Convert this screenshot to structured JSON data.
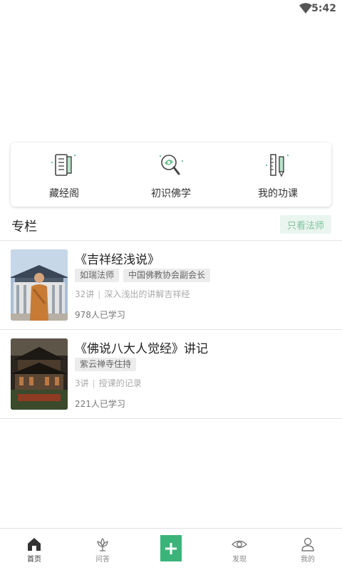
{
  "status_bar": {
    "time": "5:42"
  },
  "quick_links": [
    {
      "label": "藏经阁",
      "icon": "scripture-book-icon"
    },
    {
      "label": "初识佛学",
      "icon": "magnifier-leaf-icon"
    },
    {
      "label": "我的功课",
      "icon": "ruler-pencil-icon"
    }
  ],
  "section": {
    "title": "专栏",
    "filter_label": "只看法师"
  },
  "courses": [
    {
      "title": "《吉祥经浅说》",
      "tags": [
        "如瑞法师",
        "中国佛教协会副会长"
      ],
      "lecture_count": "32讲",
      "description": "深入浅出的讲解吉祥经",
      "learners": "978人已学习"
    },
    {
      "title": "《佛说八大人觉经》讲记",
      "tags": [
        "紫云禅寺住持"
      ],
      "lecture_count": "3讲",
      "description": "授课的记录",
      "learners": "221人已学习"
    }
  ],
  "tab_bar": {
    "tabs": [
      {
        "label": "首页",
        "icon": "home-icon"
      },
      {
        "label": "问答",
        "icon": "lotus-icon"
      },
      {
        "label": "发现",
        "icon": "eye-icon"
      },
      {
        "label": "我的",
        "icon": "user-icon"
      }
    ],
    "center_icon": "plus-icon"
  },
  "colors": {
    "accent": "#3bb47a",
    "accent_light": "#eaf5ef"
  }
}
